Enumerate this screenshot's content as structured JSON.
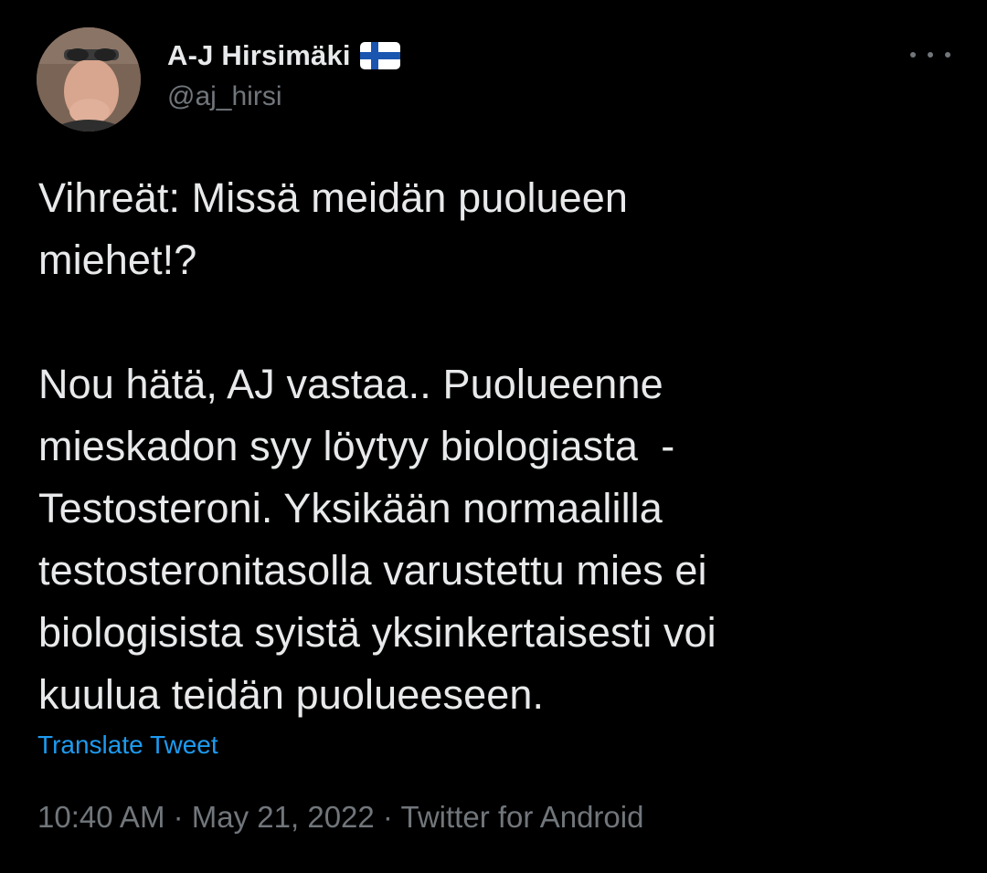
{
  "author": {
    "display_name": "A-J Hirsimäki",
    "handle": "@aj_hirsi",
    "flag_icon": "finland-flag-icon",
    "avatar_icon": "profile-photo"
  },
  "menu": {
    "icon": "more-options-icon"
  },
  "tweet": {
    "text": "Vihreät: Missä meidän puolueen\nmiehet!?\n\nNou hätä, AJ vastaa.. Puolueenne\nmieskadon syy löytyy biologiasta  -\nTestosteroni. Yksikään normaalilla\ntestosteronitasolla varustettu mies ei\nbiologisista syistä yksinkertaisesti voi\nkuulua teidän puolueeseen.",
    "translate_label": "Translate Tweet"
  },
  "meta": {
    "time": "10:40 AM",
    "separator": "·",
    "date": "May 21, 2022",
    "source": "Twitter for Android"
  },
  "colors": {
    "background": "#000000",
    "text": "#e7e9ea",
    "secondary": "#71767b",
    "link": "#1d9bf0"
  }
}
